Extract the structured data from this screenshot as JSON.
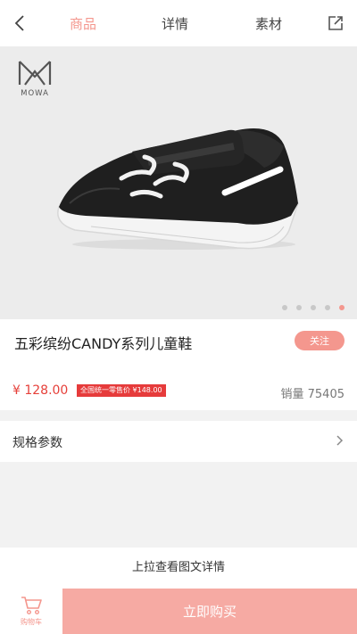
{
  "header": {
    "tabs": [
      {
        "label": "商品",
        "active": true
      },
      {
        "label": "详情",
        "active": false
      },
      {
        "label": "素材",
        "active": false
      }
    ],
    "back_icon": "chevron-left-icon",
    "share_icon": "share-external-icon"
  },
  "gallery": {
    "brand": "MOWA",
    "image_count": 5,
    "active_index": 4
  },
  "product": {
    "title": "五彩缤纷CANDY系列儿童鞋",
    "follow_label": "关注",
    "price": "¥ 128.00",
    "msrp_tag": "全国统一零售价 ¥148.00",
    "sales": "销量 75405"
  },
  "specs": {
    "label": "规格参数"
  },
  "hint": {
    "pull_up": "上拉查看图文详情"
  },
  "footer": {
    "cart_label": "购物车",
    "buy_label": "立即购买"
  },
  "colors": {
    "accent": "#f4978e",
    "buy_button": "#f6aaa3",
    "price": "#e6403a",
    "msrp_bg": "#e63b3b"
  }
}
